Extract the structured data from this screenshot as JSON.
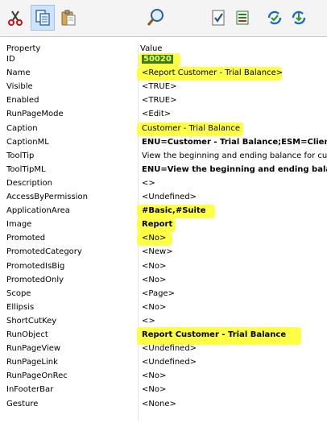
{
  "toolbar": {
    "buttons": [
      {
        "name": "cut-icon"
      },
      {
        "name": "copy-icon"
      },
      {
        "name": "paste-icon"
      },
      {
        "name": "find-icon"
      },
      {
        "name": "validate-icon"
      },
      {
        "name": "export-icon"
      },
      {
        "name": "sync-back-icon"
      },
      {
        "name": "sync-forward-icon"
      }
    ]
  },
  "table": {
    "headers": {
      "property": "Property",
      "value": "Value"
    },
    "rows": [
      {
        "property": "ID",
        "value": "50020"
      },
      {
        "property": "Name",
        "value": "<Report Customer - Trial Balance>"
      },
      {
        "property": "Visible",
        "value": "<TRUE>"
      },
      {
        "property": "Enabled",
        "value": "<TRUE>"
      },
      {
        "property": "RunPageMode",
        "value": "<Edit>"
      },
      {
        "property": "Caption",
        "value": "Customer - Trial Balance"
      },
      {
        "property": "CaptionML",
        "value": "ENU=Customer - Trial Balance;ESM=Client"
      },
      {
        "property": "ToolTip",
        "value": "View the beginning and ending balance for custo"
      },
      {
        "property": "ToolTipML",
        "value": "ENU=View the beginning and ending bala"
      },
      {
        "property": "Description",
        "value": "<>"
      },
      {
        "property": "AccessByPermission",
        "value": "<Undefined>"
      },
      {
        "property": "ApplicationArea",
        "value": "#Basic,#Suite"
      },
      {
        "property": "Image",
        "value": "Report"
      },
      {
        "property": "Promoted",
        "value": "<No>"
      },
      {
        "property": "PromotedCategory",
        "value": "<New>"
      },
      {
        "property": "PromotedIsBig",
        "value": "<No>"
      },
      {
        "property": "PromotedOnly",
        "value": "<No>"
      },
      {
        "property": "Scope",
        "value": "<Page>"
      },
      {
        "property": "Ellipsis",
        "value": "<No>"
      },
      {
        "property": "ShortCutKey",
        "value": "<>"
      },
      {
        "property": "RunObject",
        "value": "Report Customer - Trial Balance"
      },
      {
        "property": "RunPageView",
        "value": "<Undefined>"
      },
      {
        "property": "RunPageLink",
        "value": "<Undefined>"
      },
      {
        "property": "RunPageOnRec",
        "value": "<No>"
      },
      {
        "property": "InFooterBar",
        "value": "<No>"
      },
      {
        "property": "Gesture",
        "value": "<None>"
      }
    ]
  },
  "colors": {
    "highlight": "#ffff3c",
    "id_background": "#3d7c12",
    "id_text": "#eaff6a"
  }
}
